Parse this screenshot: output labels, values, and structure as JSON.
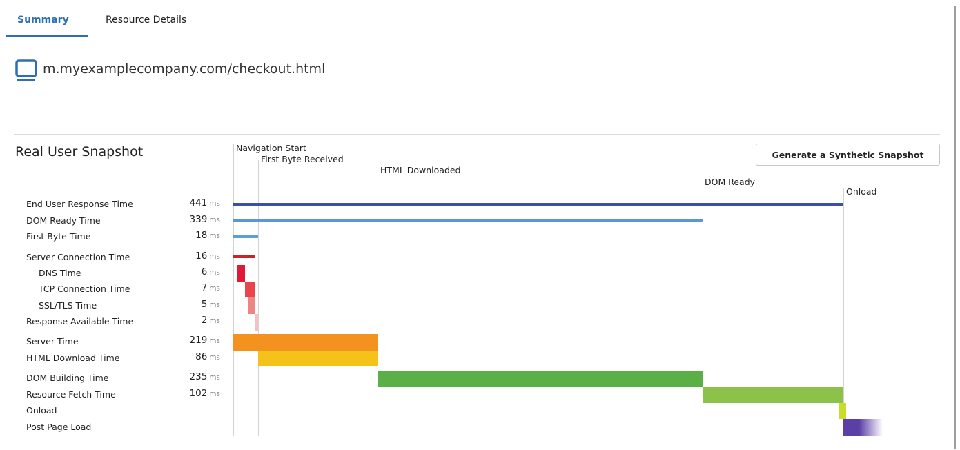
{
  "tabs": [
    {
      "label": "Summary",
      "active": true
    },
    {
      "label": "Resource Details",
      "active": false
    }
  ],
  "page": {
    "icon": "monitor-icon",
    "url": "m.myexamplecompany.com/checkout.html"
  },
  "snapshot": {
    "title": "Real User Snapshot",
    "generate_button": "Generate a Synthetic Snapshot"
  },
  "milestones": [
    {
      "label": "Navigation Start"
    },
    {
      "label": "First Byte Received"
    },
    {
      "label": "HTML Downloaded"
    },
    {
      "label": "DOM Ready"
    },
    {
      "label": "Onload"
    }
  ],
  "unit": "ms",
  "metrics": [
    {
      "label": "End User Response Time",
      "value": "441",
      "color": "#3d4fa1"
    },
    {
      "label": "DOM Ready Time",
      "value": "339",
      "color": "#5b97d4"
    },
    {
      "label": "First Byte Time",
      "value": "18",
      "color": "#5b9fd8"
    },
    {
      "label": "Server Connection Time",
      "value": "16",
      "color": "#c6252b"
    },
    {
      "label": "DNS Time",
      "value": "6",
      "color": "#e0183a"
    },
    {
      "label": "TCP Connection Time",
      "value": "7",
      "color": "#e8454e"
    },
    {
      "label": "SSL/TLS Time",
      "value": "5",
      "color": "#ef8583"
    },
    {
      "label": "Response Available Time",
      "value": "2",
      "color": "#f7c1c4"
    },
    {
      "label": "Server Time",
      "value": "219",
      "color": "#f4921f"
    },
    {
      "label": "HTML Download Time",
      "value": "86",
      "color": "#f5c21a"
    },
    {
      "label": "DOM Building Time",
      "value": "235",
      "color": "#5aaf47"
    },
    {
      "label": "Resource Fetch Time",
      "value": "102",
      "color": "#8cc14a"
    },
    {
      "label": "Onload",
      "value": "",
      "color": "#c9dc2a"
    },
    {
      "label": "Post Page Load",
      "value": "",
      "color": "#5b3fa6"
    }
  ]
}
